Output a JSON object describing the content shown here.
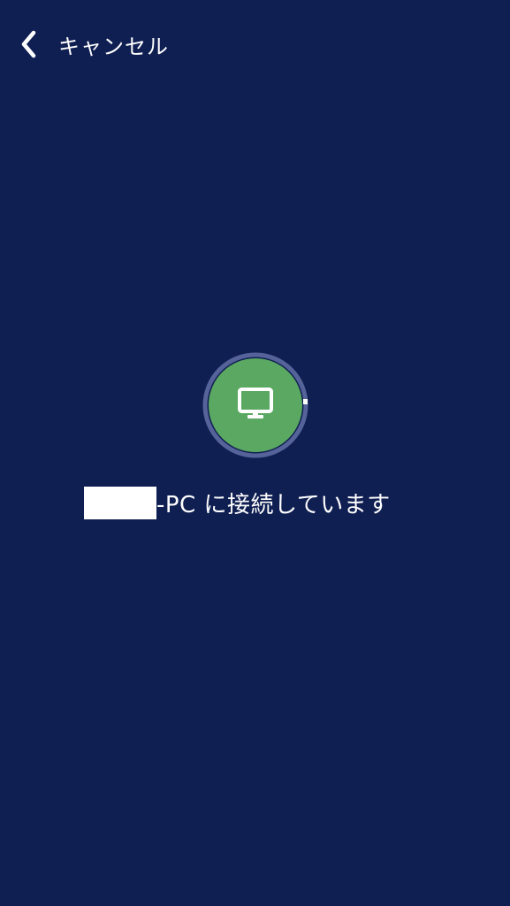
{
  "nav": {
    "back_icon": "chevron-left-icon",
    "cancel_label": "キャンセル"
  },
  "connection": {
    "device_icon": "monitor-icon",
    "status_text": "-PC に接続しています",
    "device_name_redacted": true
  },
  "colors": {
    "background": "#101f52",
    "device_circle": "#5aa862",
    "progress_ring": "#55639a",
    "text": "#ffffff"
  }
}
